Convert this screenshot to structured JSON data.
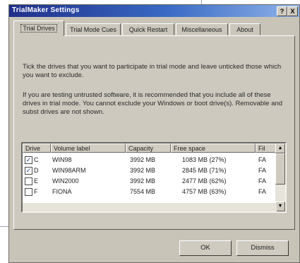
{
  "window": {
    "title": "TrialMaker Settings",
    "help_btn": "?",
    "close_btn": "X"
  },
  "tabs": [
    {
      "label": "Trial Drives"
    },
    {
      "label": "Trial Mode Cues"
    },
    {
      "label": "Quick Restart"
    },
    {
      "label": "Miscellaneous"
    },
    {
      "label": "About"
    }
  ],
  "panel": {
    "intro": "Tick the drives that you want to participate in trial mode and leave unticked those which you want to exclude.",
    "note": "If you are testing untrusted software, it is recommended that you include all of these drives in trial mode. You cannot exclude your Windows or boot drive(s). Removable and subst drives are not shown."
  },
  "drive_list": {
    "columns": [
      "Drive",
      "Volume label",
      "Capacity",
      "Free space",
      "Fil"
    ],
    "rows": [
      {
        "checked": true,
        "drive": "C",
        "label": "WIN98",
        "capacity": "3992 MB",
        "free": "1083 MB (27%)",
        "fs": "FA"
      },
      {
        "checked": true,
        "drive": "D",
        "label": "WIN98ARM",
        "capacity": "3992 MB",
        "free": "2845 MB (71%)",
        "fs": "FA"
      },
      {
        "checked": false,
        "drive": "E",
        "label": "WIN2000",
        "capacity": "3992 MB",
        "free": "2477 MB (62%)",
        "fs": "FA"
      },
      {
        "checked": false,
        "drive": "F",
        "label": "FIONA",
        "capacity": "7554 MB",
        "free": "4757 MB (63%)",
        "fs": "FA"
      }
    ]
  },
  "buttons": {
    "ok": "OK",
    "dismiss": "Dismiss"
  }
}
